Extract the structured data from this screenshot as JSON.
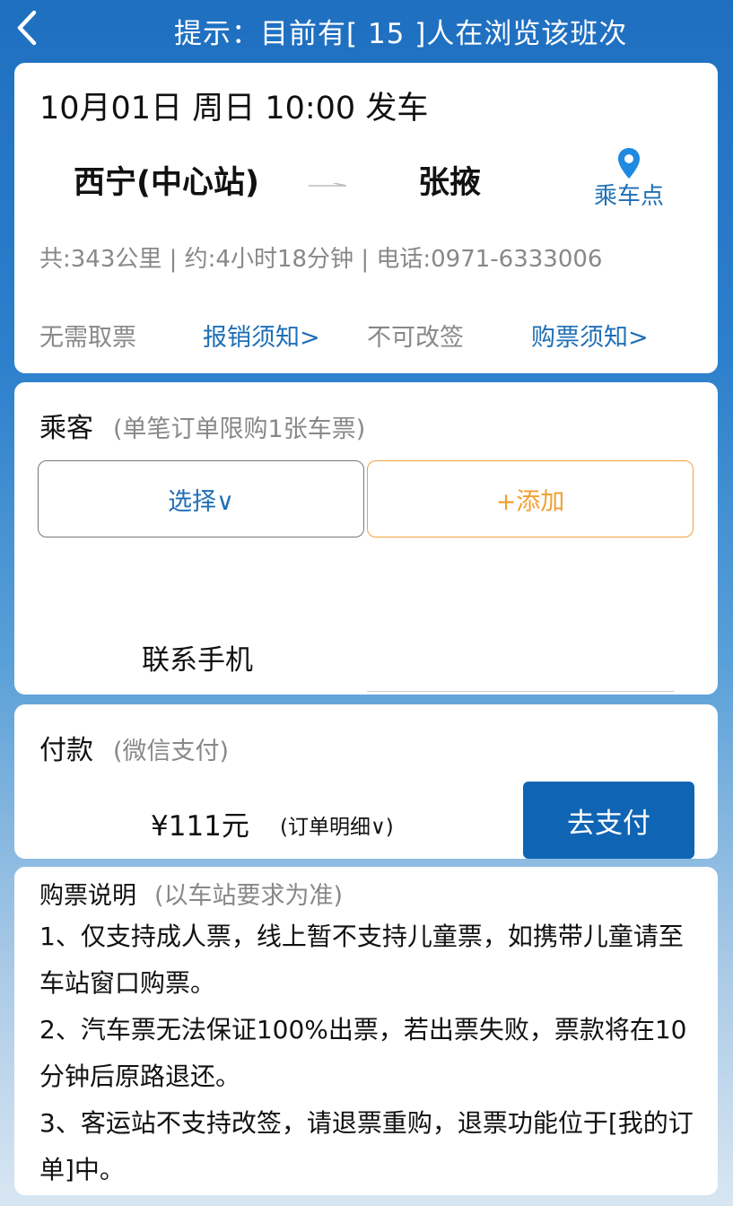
{
  "header": {
    "back_icon": "chevron-left-icon",
    "title": "提示：目前有[ 15 ]人在浏览该班次"
  },
  "trip": {
    "departure": "10月01日 周日 10:00 发车",
    "from": "西宁(中心站)",
    "to": "张掖",
    "pickup_icon": "location-pin-icon",
    "pickup_label": "乘车点",
    "info": "共:343公里 | 约:4小时18分钟 | 电话:0971-6333006",
    "tags": [
      "无需取票",
      "报销须知>",
      "不可改签",
      "购票须知>"
    ],
    "link_color": "#1f6fb5"
  },
  "passenger": {
    "title": "乘客",
    "subtitle": "(单笔订单限购1张车票)",
    "select_label": "选择∨",
    "add_label": "+添加",
    "phone_label": "联系手机",
    "phone_value": "",
    "add_color": "#f0a030"
  },
  "payment": {
    "title": "付款",
    "subtitle": "(微信支付)",
    "price": "¥111元",
    "detail": "(订单明细∨)",
    "pay_button": "去支付",
    "pay_button_color": "#0f64b4"
  },
  "notes": {
    "title": "购票说明",
    "subtitle": "(以车站要求为准)",
    "items": [
      "1、仅支持成人票，线上暂不支持儿童票，如携带儿童请至车站窗口购票。",
      "2、汽车票无法保证100%出票，若出票失败，票款将在10分钟后原路退还。",
      "3、客运站不支持改签，请退票重购，退票功能位于[我的订单]中。"
    ]
  }
}
